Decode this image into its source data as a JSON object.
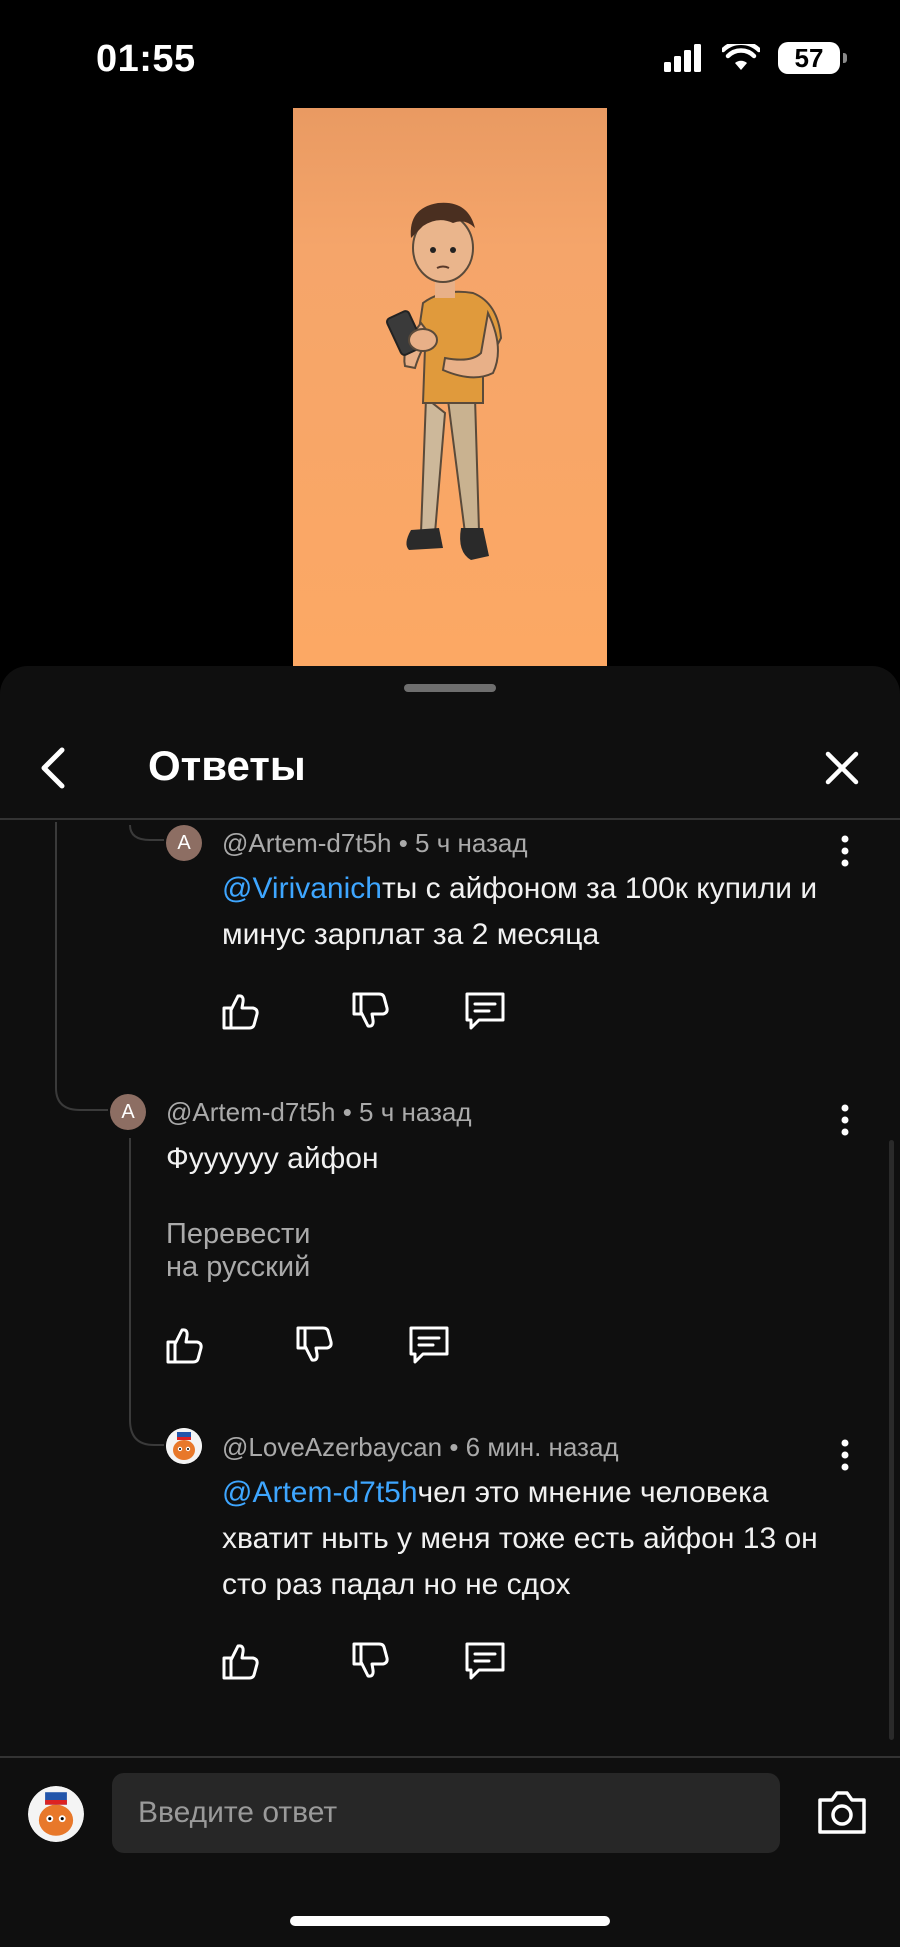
{
  "status_bar": {
    "time": "01:55",
    "battery": "57"
  },
  "panel": {
    "title": "Ответы"
  },
  "comments": [
    {
      "author": "@Artem-d7t5h",
      "avatar_letter": "A",
      "time": "5 ч назад",
      "mention": "@Virivanich",
      "text": "ты с айфоном за 100к купили и минус зарплат за 2 месяца"
    },
    {
      "author": "@Artem-d7t5h",
      "avatar_letter": "A",
      "time": "5 ч назад",
      "text": "Фуууууу айфон",
      "translate": "Перевести на русский"
    },
    {
      "author": "@LoveAzerbaycan",
      "time": "6 мин. назад",
      "mention": "@Artem-d7t5h",
      "text": "чел это мнение человека хватит ныть у меня тоже есть айфон 13 он сто раз падал но не сдох"
    }
  ],
  "composer": {
    "placeholder": "Введите ответ"
  },
  "icons": {
    "back": "chevron-left-icon",
    "close": "close-icon",
    "like": "thumbs-up-icon",
    "dislike": "thumbs-down-icon",
    "reply": "comment-icon",
    "more": "more-vertical-icon",
    "camera": "camera-icon"
  },
  "colors": {
    "background": "#0f0f0f",
    "mention": "#3ea6ff",
    "video_bg": "#f5a56a"
  }
}
